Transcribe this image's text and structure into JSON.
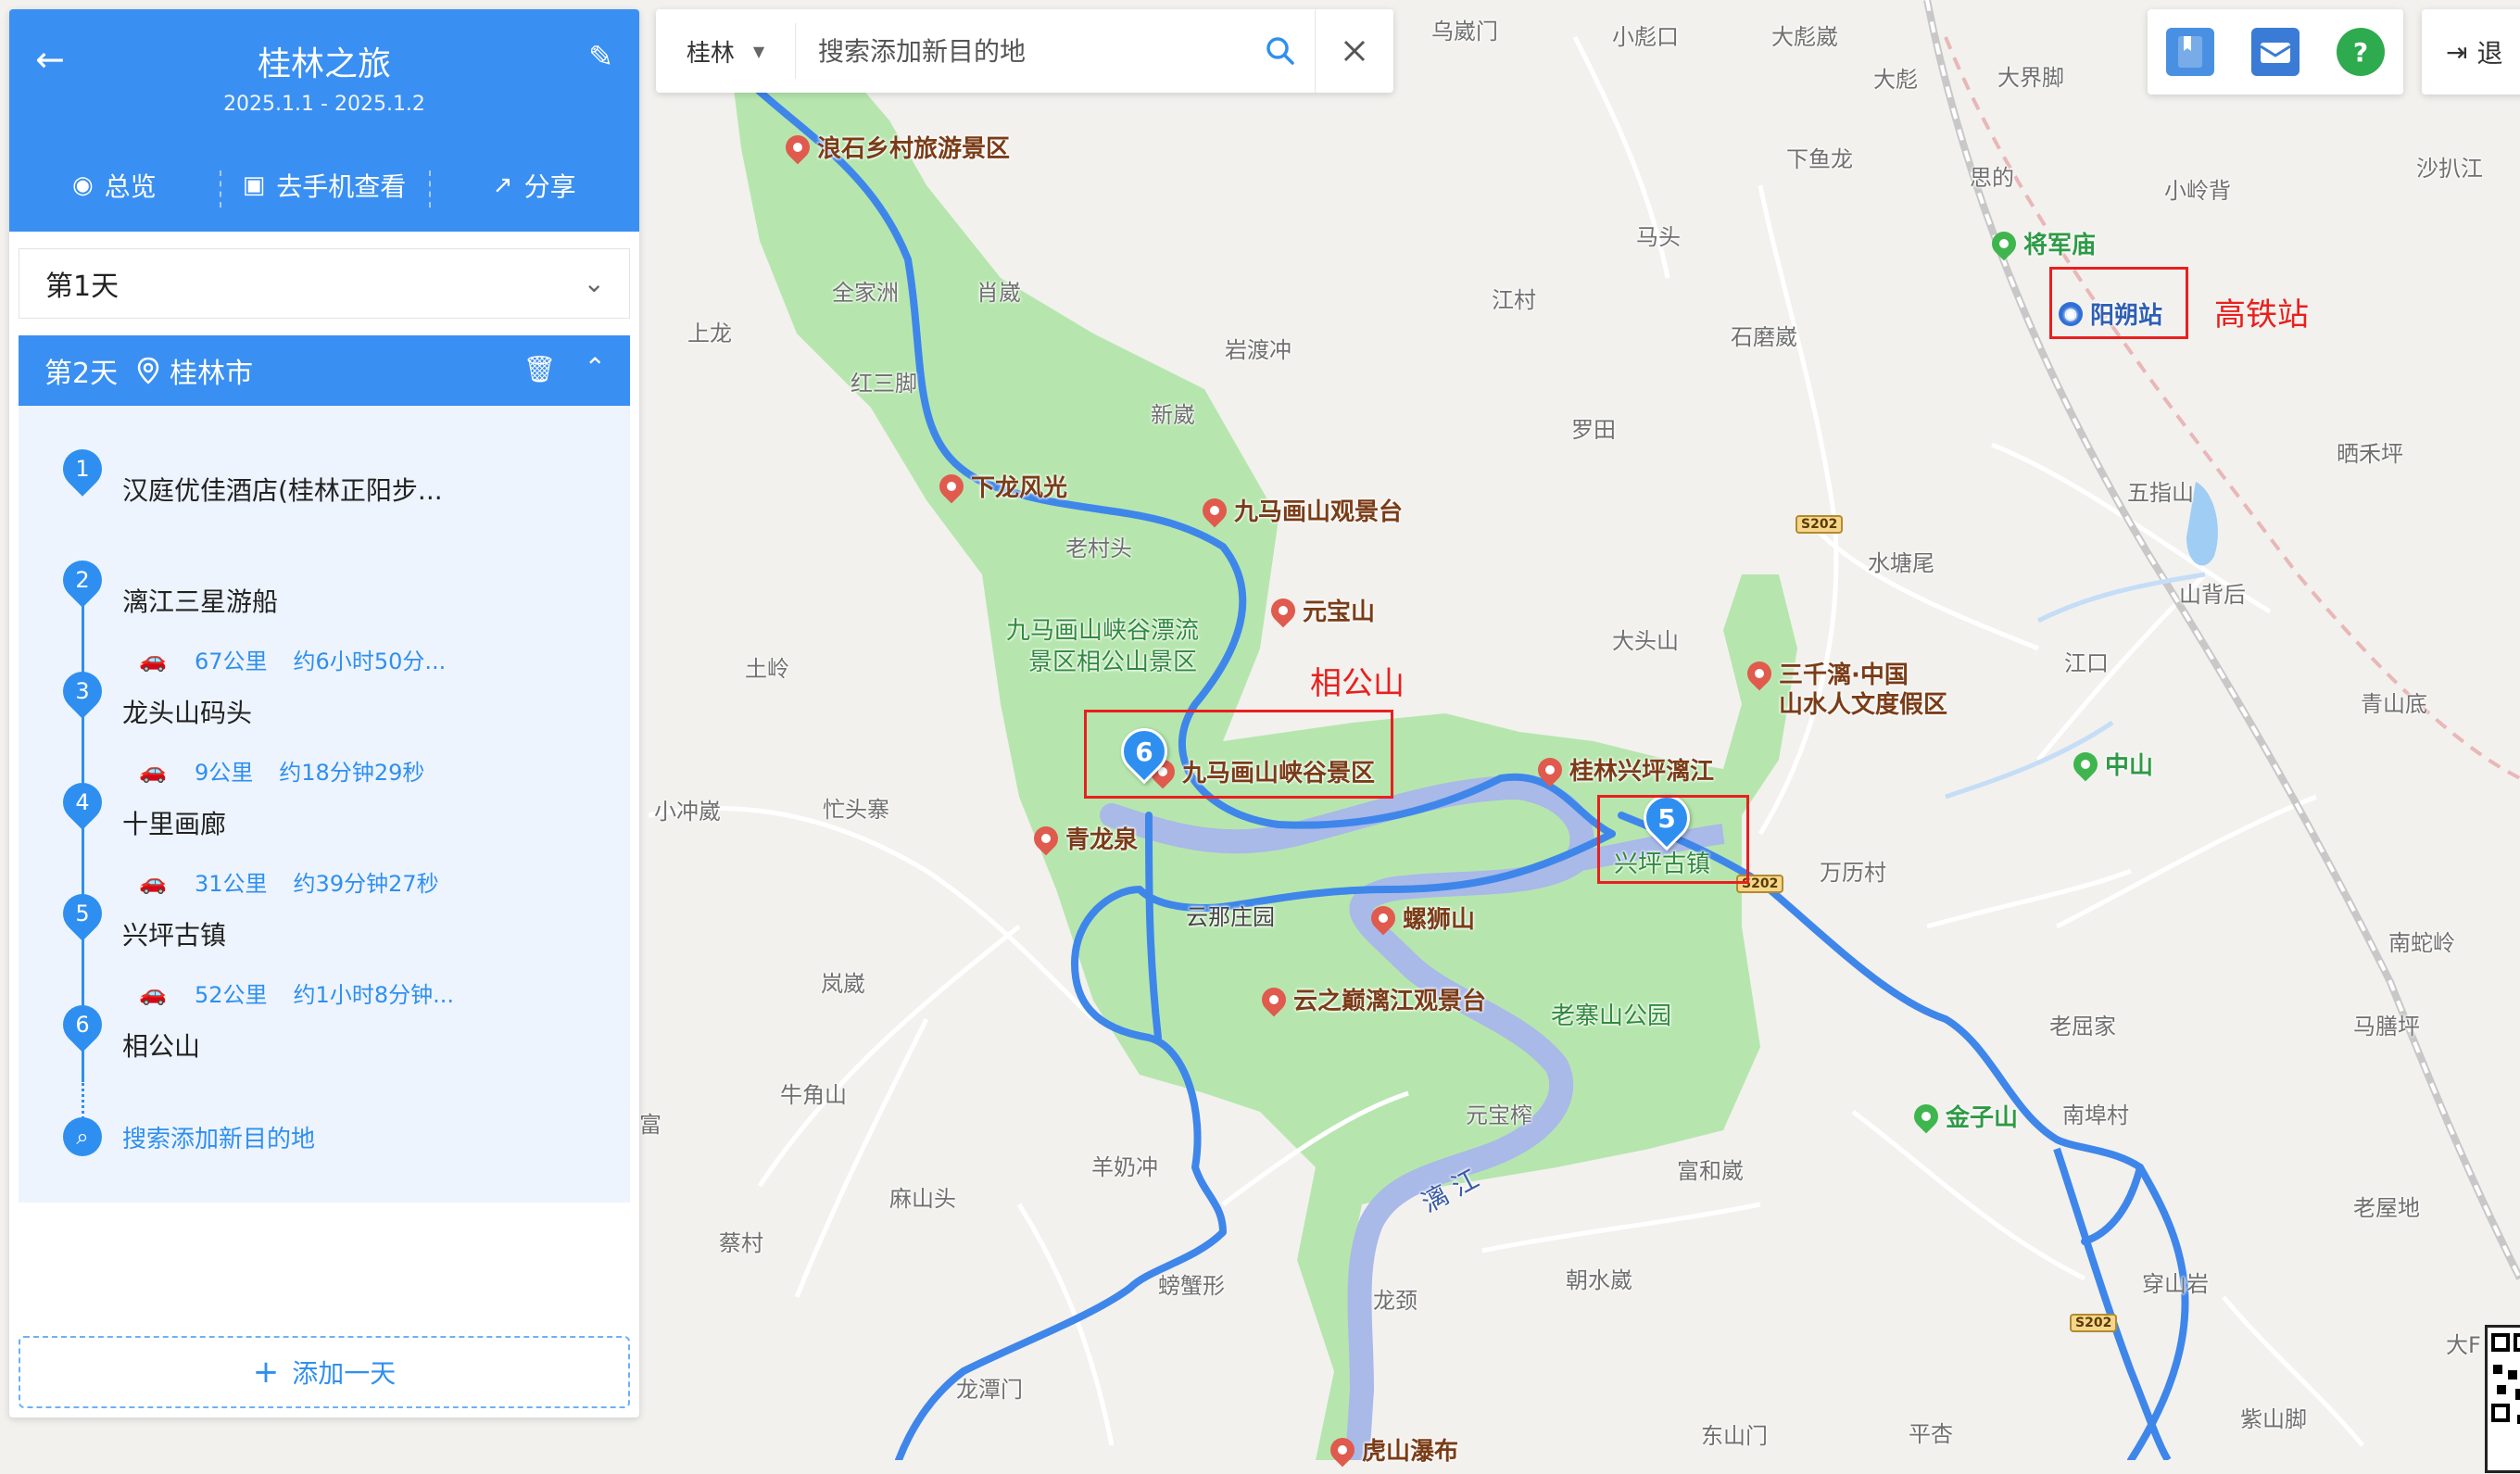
{
  "trip": {
    "title": "桂林之旅",
    "dates": "2025.1.1 - 2025.1.2",
    "actions": [
      {
        "label": "总览",
        "icon": "eye-icon"
      },
      {
        "label": "去手机查看",
        "icon": "phone-icon"
      },
      {
        "label": "分享",
        "icon": "share-icon"
      }
    ]
  },
  "day1": {
    "label": "第1天"
  },
  "day2": {
    "label": "第2天",
    "location": "桂林市"
  },
  "stops": [
    {
      "num": "1",
      "name": "汉庭优佳酒店(桂林正阳步..."
    },
    {
      "num": "2",
      "name": "漓江三星游船"
    },
    {
      "num": "3",
      "name": "龙头山码头"
    },
    {
      "num": "4",
      "name": "十里画廊"
    },
    {
      "num": "5",
      "name": "兴坪古镇"
    },
    {
      "num": "6",
      "name": "相公山"
    }
  ],
  "segments": [
    {
      "distance": "67公里",
      "time": "约6小时50分..."
    },
    {
      "distance": "9公里",
      "time": "约18分钟29秒"
    },
    {
      "distance": "31公里",
      "time": "约39分钟27秒"
    },
    {
      "distance": "52公里",
      "time": "约1小时8分钟..."
    }
  ],
  "search_add": "搜索添加新目的地",
  "add_day": "添加一天",
  "search": {
    "city": "桂林",
    "placeholder": "搜索添加新目的地"
  },
  "toolbar": {
    "icons": [
      "bookmark-icon",
      "message-icon",
      "help-icon"
    ],
    "help_glyph": "?",
    "colors": {
      "bookmark": "#4a90e2",
      "message": "#3a7bd5",
      "help": "#2eaa4f"
    }
  },
  "exit": {
    "label": "退"
  },
  "map": {
    "places": [
      "乌崴门",
      "小彪口",
      "大彪崴",
      "大彪",
      "大界脚",
      "下鱼龙",
      "思的",
      "沙扒江",
      "小岭背",
      "马头",
      "江村",
      "全家洲",
      "肖崴",
      "上龙",
      "石磨崴",
      "红三脚",
      "岩渡冲",
      "新崴",
      "罗田",
      "晒禾坪",
      "五指山",
      "老村头",
      "水塘尾",
      "山背后",
      "大头山",
      "土岭",
      "江口",
      "青山底",
      "小冲崴",
      "忙头寨",
      "万历村",
      "南蛇岭",
      "岚崴",
      "老屈家",
      "马膳坪",
      "牛角山",
      "元宝榨",
      "南埠村",
      "富",
      "羊奶冲",
      "富和崴",
      "麻山头",
      "老屋地",
      "蔡村",
      "螃蟹形",
      "朝水崴",
      "穿山岩",
      "龙颈",
      "东山门",
      "平杏",
      "紫山脚",
      "龙潭门",
      "大F",
      "九马画山峡谷漂流",
      "景区相公山景区",
      "老寨山公园",
      "漓 江",
      "兴坪古镇",
      "云那庄园"
    ],
    "pois": [
      "浪石乡村旅游景区",
      "下龙风光",
      "九马画山观景台",
      "元宝山",
      "九马画山峡谷景区",
      "青龙泉",
      "螺狮山",
      "云之巅漓江观景台",
      "桂林兴坪漓江",
      "三千漓·中国",
      "山水人文度假区",
      "虎山瀑布"
    ],
    "green_pois": [
      "将军庙",
      "中山",
      "金子山"
    ],
    "station": "阳朔站",
    "roads": [
      "S202",
      "S202",
      "S202"
    ],
    "markers": [
      "6",
      "5"
    ],
    "annotations": [
      "相公山",
      "高铁站"
    ]
  }
}
